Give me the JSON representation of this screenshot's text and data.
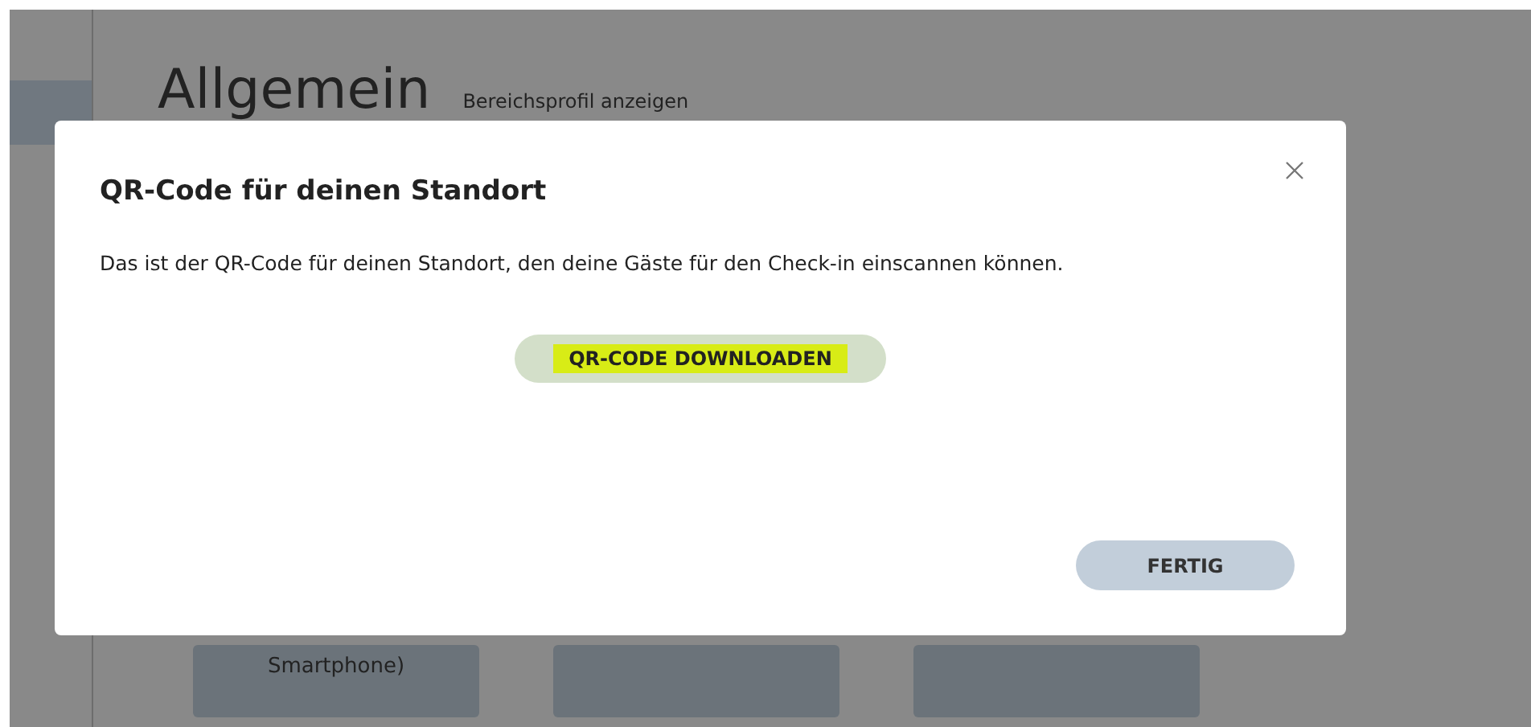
{
  "page": {
    "title": "Allgemein",
    "profile_link": "Bereichsprofil anzeigen",
    "cards": [
      {
        "kind": "labeled",
        "label": "Smartphone)"
      },
      {
        "kind": "blank"
      },
      {
        "kind": "blank"
      }
    ]
  },
  "dialog": {
    "title": "QR-Code für deinen Standort",
    "message": "Das ist der QR-Code für deinen Standort, den deine Gäste für den Check-in einscannen können.",
    "download_button": {
      "label": "QR-CODE DOWNLOADEN",
      "highlighted": true
    },
    "done_button": "FERTIG"
  }
}
